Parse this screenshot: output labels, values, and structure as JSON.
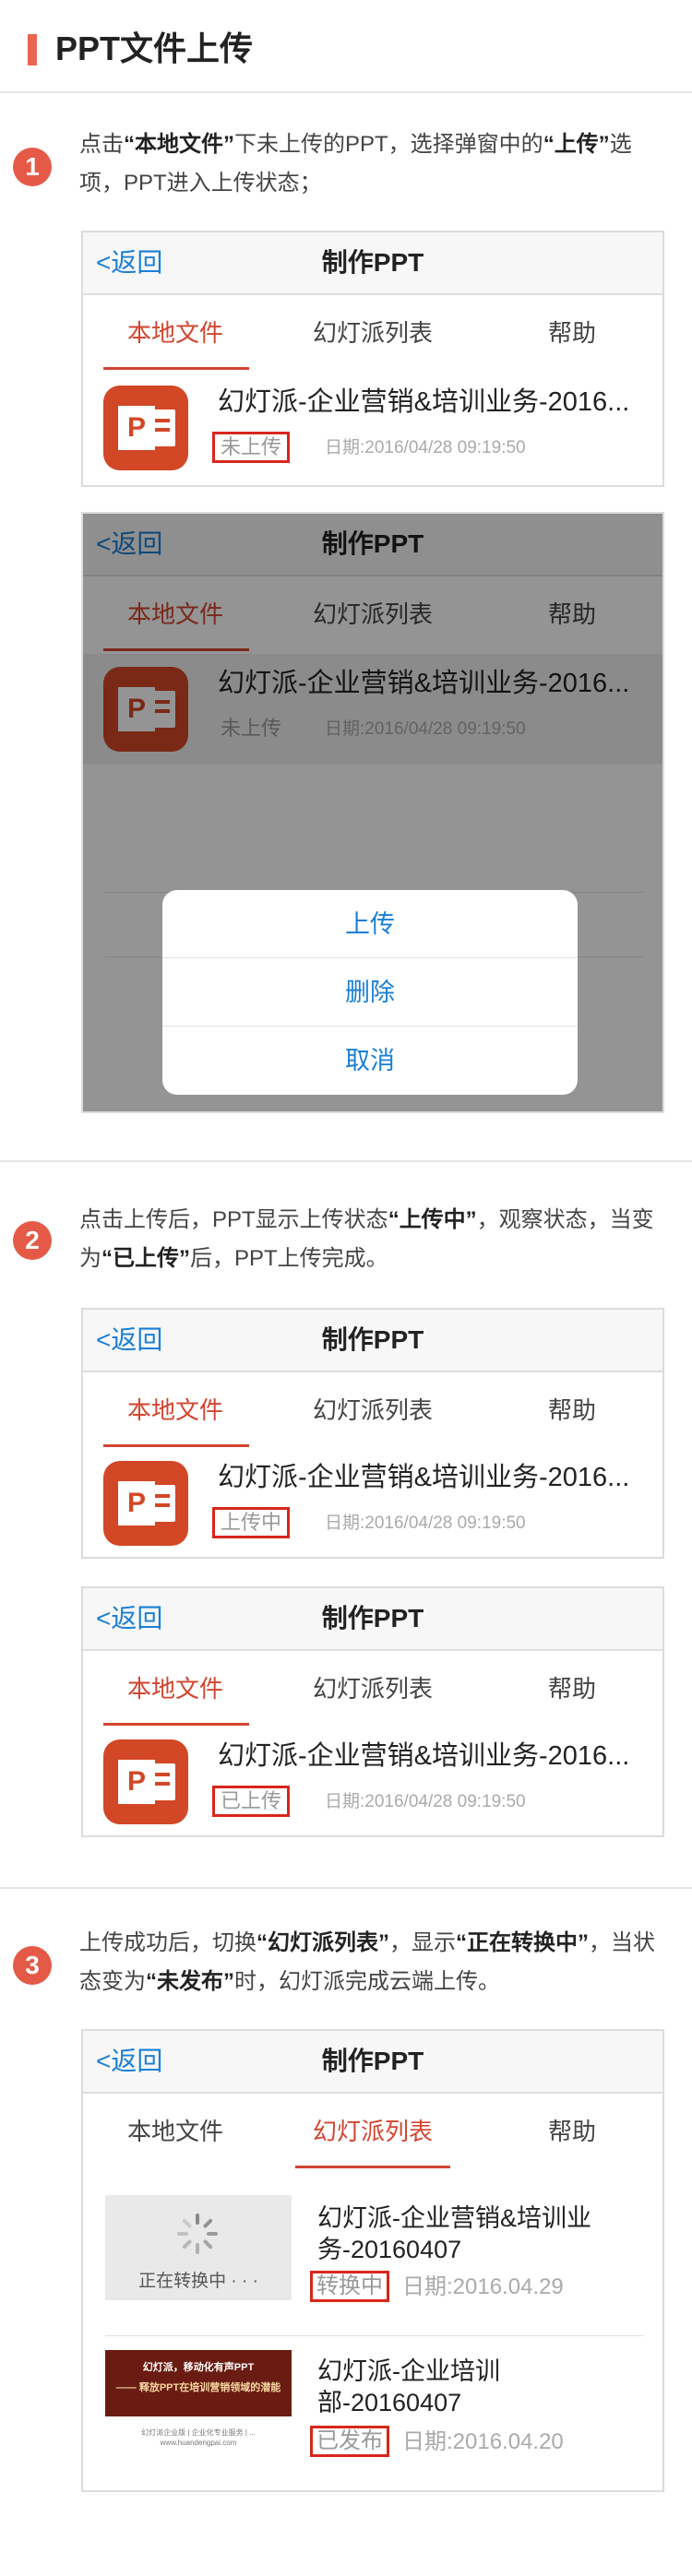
{
  "page": {
    "title": "PPT文件上传"
  },
  "steps": [
    {
      "num": "1",
      "text_parts": [
        "点击",
        "“本地文件”",
        "下未上传的PPT，选择弹窗中的",
        "“上传”",
        "选项，PPT进入上传状态；"
      ]
    },
    {
      "num": "2",
      "text_parts": [
        "点击上传后，PPT显示上传状态",
        "“上传中”",
        "，观察状态，当变为",
        "“已上传”",
        "后，PPT上传完成。"
      ]
    },
    {
      "num": "3",
      "text_parts": [
        "上传成功后，切换",
        "“幻灯派列表”",
        "，显示",
        "“正在转换中”",
        "，当状态变为",
        "“未发布”",
        "时，幻灯派完成云端上传。"
      ]
    }
  ],
  "app": {
    "back": "<返回",
    "title": "制作PPT",
    "tabs": [
      "本地文件",
      "幻灯派列表",
      "帮助"
    ]
  },
  "file": {
    "name": "幻灯派-企业营销&培训业务-2016...",
    "date": "日期:2016/04/28 09:19:50",
    "icon_letter": "P"
  },
  "status": {
    "not_uploaded": "未上传",
    "uploading": "上传中",
    "uploaded": "已上传"
  },
  "action_sheet": {
    "options": [
      "上传",
      "删除",
      "取消"
    ]
  },
  "list_items": [
    {
      "title": "幻灯派-企业营销&培训业务-20160407",
      "status": "转换中",
      "date": "日期:2016.04.29",
      "thumb_label": "正在转换中 · · ·"
    },
    {
      "title": "幻灯派-企业培训部-20160407",
      "status": "已发布",
      "date": "日期:2016.04.20",
      "banner_line1": "幻灯派，移动化有声PPT",
      "banner_line2": "—— 释放PPT在培训营销领域的潜能",
      "banner_line3": "幻灯派企业版 | 企业化专业服务 | ...\nwww.huandengpai.com"
    }
  ],
  "colors": {
    "accent": "#d2452f",
    "link": "#1a7fd5",
    "highlight_box": "#d8271c",
    "step_badge": "#e55a47"
  }
}
